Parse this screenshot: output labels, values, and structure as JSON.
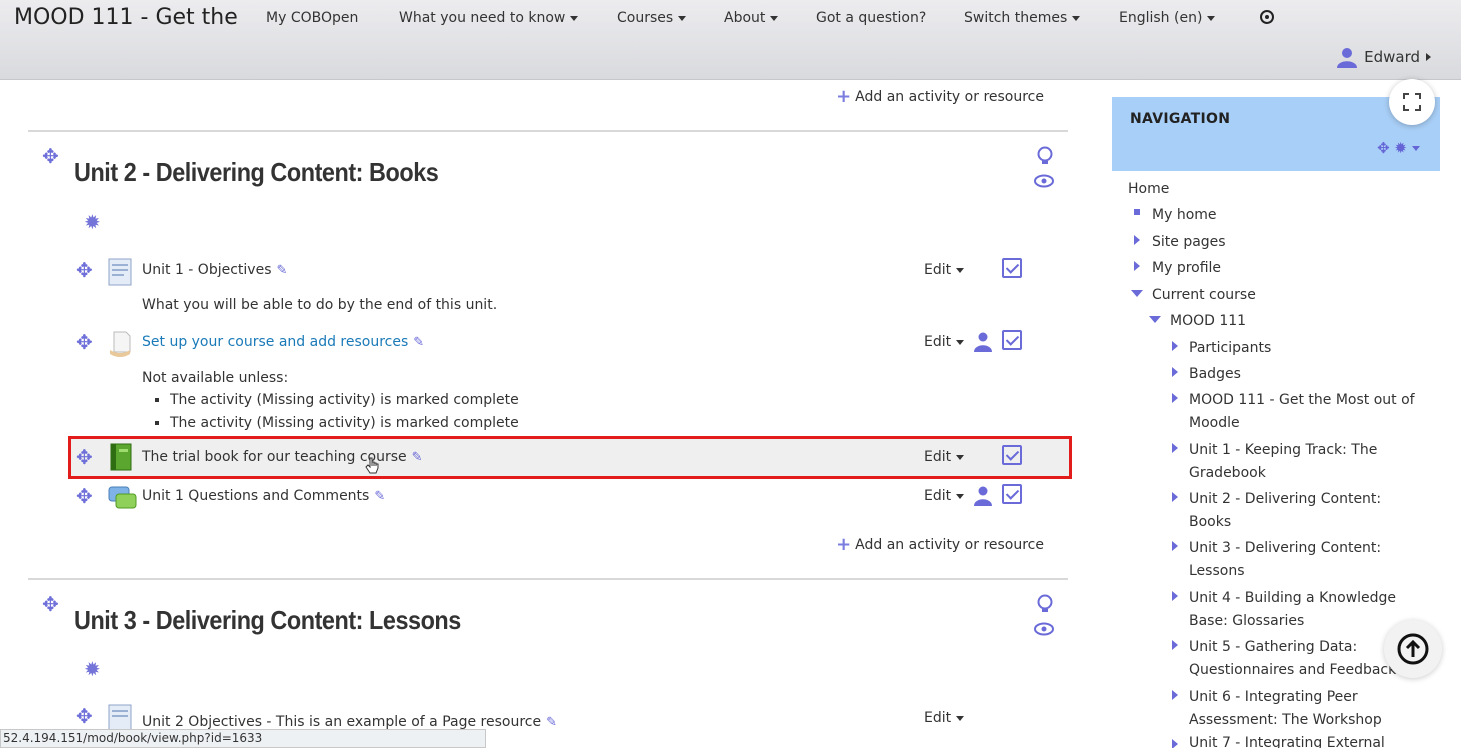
{
  "topnav": {
    "site_title": "MOOD 111 - Get the",
    "items": [
      {
        "label": "My COBOpen",
        "dropdown": false
      },
      {
        "label": "What you need to know",
        "dropdown": true
      },
      {
        "label": "Courses",
        "dropdown": true
      },
      {
        "label": "About",
        "dropdown": true
      },
      {
        "label": "Got a question?",
        "dropdown": false
      },
      {
        "label": "Switch themes",
        "dropdown": true
      },
      {
        "label": "English (en)",
        "dropdown": true
      }
    ],
    "user_name": "Edward"
  },
  "main": {
    "add_activity_label": "Add an activity or resource",
    "sections": [
      {
        "title": "Unit 2 - Delivering Content: Books",
        "activities": [
          {
            "name": "Unit 1 - Objectives",
            "description": "What you will be able to do by the end of this unit.",
            "edit": "Edit"
          },
          {
            "name": "Set up your course and add resources",
            "edit": "Edit",
            "restriction_title": "Not available unless:",
            "restrictions": [
              "The activity (Missing activity) is marked complete",
              "The activity (Missing activity) is marked complete"
            ]
          },
          {
            "name": "The trial book for our teaching course",
            "edit": "Edit"
          },
          {
            "name": "Unit 1 Questions and Comments",
            "edit": "Edit"
          }
        ]
      },
      {
        "title": "Unit 3 - Delivering Content: Lessons",
        "activities": [
          {
            "name": "Unit 2 Objectives - This is an example of a Page resource",
            "edit": "Edit"
          }
        ]
      }
    ]
  },
  "navigation": {
    "title": "NAVIGATION",
    "items": [
      {
        "label": "Home"
      },
      {
        "label": "My home"
      },
      {
        "label": "Site pages"
      },
      {
        "label": "My profile"
      },
      {
        "label": "Current course"
      },
      {
        "label": "MOOD 111"
      },
      {
        "label": "Participants"
      },
      {
        "label": "Badges"
      },
      {
        "label": "MOOD 111 - Get the Most out of Moodle"
      },
      {
        "label": "Unit 1 - Keeping Track: The Gradebook"
      },
      {
        "label": "Unit 2 - Delivering Content: Books"
      },
      {
        "label": "Unit 3 - Delivering Content: Lessons"
      },
      {
        "label": "Unit 4 - Building a Knowledge Base: Glossaries"
      },
      {
        "label": "Unit 5 - Gathering Data: Questionnaires and Feedback"
      },
      {
        "label": "Unit 6 - Integrating Peer Assessment: The Workshop"
      },
      {
        "label": "Unit 7 - Integrating External"
      }
    ]
  },
  "status_url": "52.4.194.151/mod/book/view.php?id=1633",
  "colors": {
    "accent": "#6a6ad8",
    "nav_header": "#a8cff7",
    "highlight_border": "#e21b1b",
    "link": "#1a7ab8"
  }
}
